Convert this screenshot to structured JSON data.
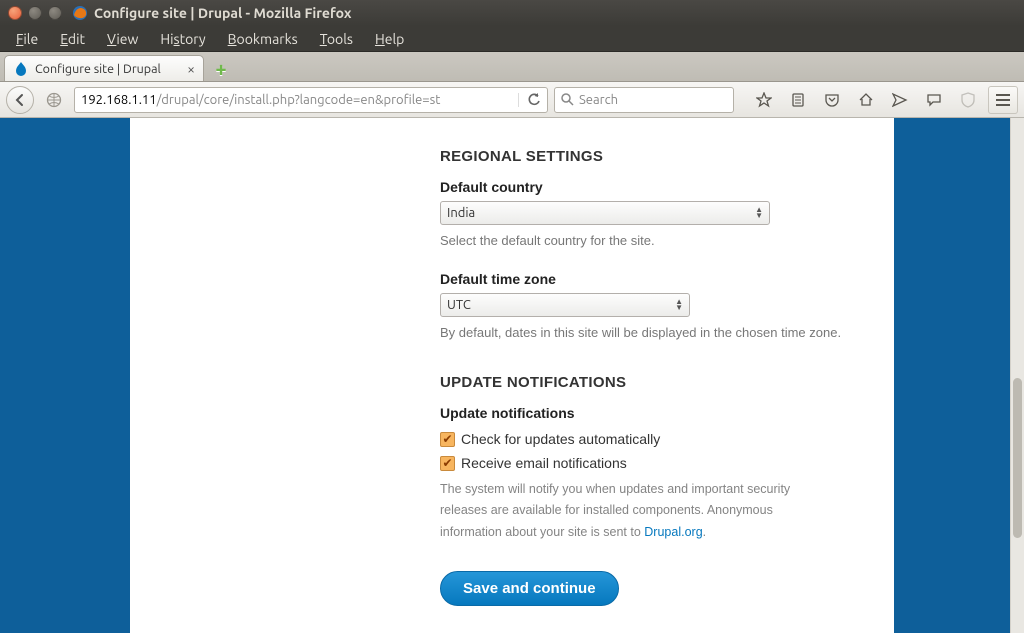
{
  "window": {
    "title": "Configure site | Drupal - Mozilla Firefox"
  },
  "menu": {
    "file": "File",
    "edit": "Edit",
    "view": "View",
    "history": "History",
    "bookmarks": "Bookmarks",
    "tools": "Tools",
    "help": "Help"
  },
  "tab": {
    "title": "Configure site | Drupal"
  },
  "url": {
    "host": "192.168.1.11",
    "path": "/drupal/core/install.php?langcode=en&profile=st"
  },
  "search": {
    "placeholder": "Search"
  },
  "form": {
    "regional": {
      "heading": "REGIONAL SETTINGS",
      "country_label": "Default country",
      "country_value": "India",
      "country_hint": "Select the default country for the site.",
      "tz_label": "Default time zone",
      "tz_value": "UTC",
      "tz_hint": "By default, dates in this site will be displayed in the chosen time zone."
    },
    "updates": {
      "heading": "UPDATE NOTIFICATIONS",
      "sub": "Update notifications",
      "check_label": "Check for updates automatically",
      "email_label": "Receive email notifications",
      "desc_pre": "The system will notify you when updates and important security releases are available for installed components. Anonymous information about your site is sent to ",
      "desc_link": "Drupal.org",
      "desc_post": "."
    },
    "submit": "Save and continue"
  }
}
